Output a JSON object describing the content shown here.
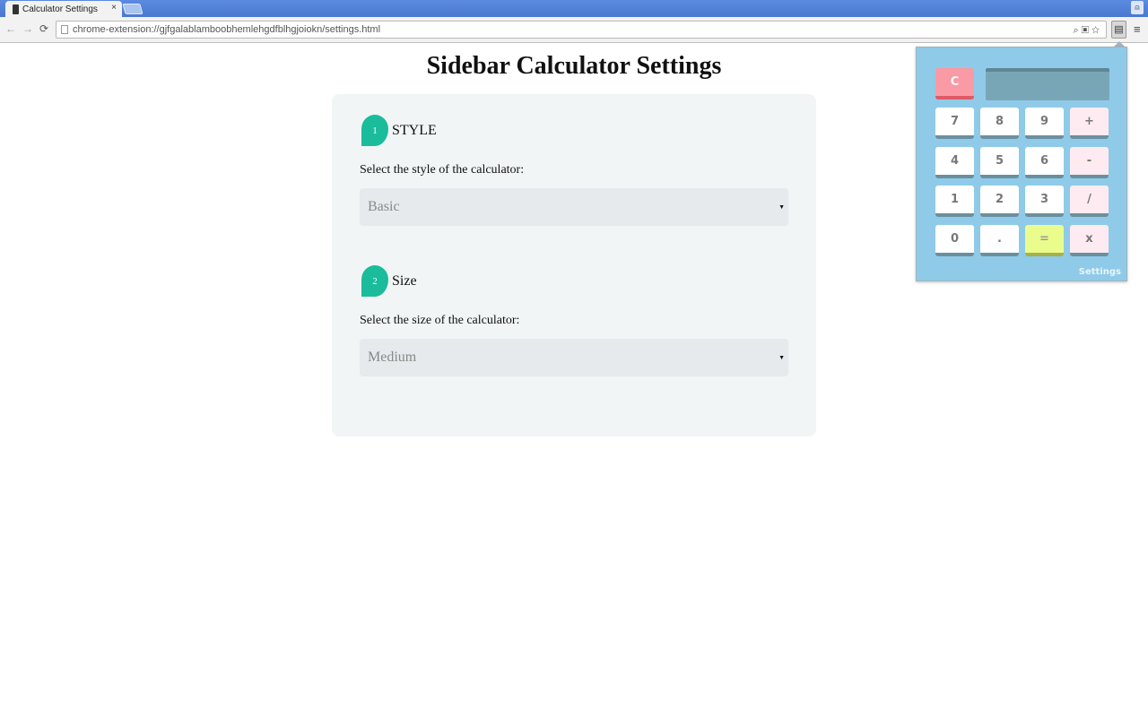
{
  "browser": {
    "tab_title": "Calculator Settings",
    "tab_close": "×",
    "url": "chrome-extension://gjfgalablamboobhemlehgdfblhgjoiokn/settings.html",
    "back": "←",
    "forward": "→",
    "reload": "⟳",
    "profile": "⍝",
    "menu": "≡",
    "ext_icon": "▤",
    "omni_icons": "⌕▣☆"
  },
  "page": {
    "title": "Sidebar Calculator Settings",
    "sections": [
      {
        "number": "1",
        "heading": "STYLE",
        "label": "Select the style of the calculator:",
        "value": "Basic"
      },
      {
        "number": "2",
        "heading": "Size",
        "label": "Select the size of the calculator:",
        "value": "Medium"
      }
    ],
    "caret": "▼"
  },
  "calculator": {
    "clear": "C",
    "display": "",
    "keys": [
      "7",
      "8",
      "9",
      "+",
      "4",
      "5",
      "6",
      "-",
      "1",
      "2",
      "3",
      "/",
      "0",
      ".",
      "=",
      "x"
    ],
    "settings_label": "Settings"
  },
  "colors": {
    "accent": "#1abc9c",
    "popup_bg": "#8fcbe8",
    "clear_key": "#f99aa5",
    "equals_key": "#eafc8c"
  }
}
